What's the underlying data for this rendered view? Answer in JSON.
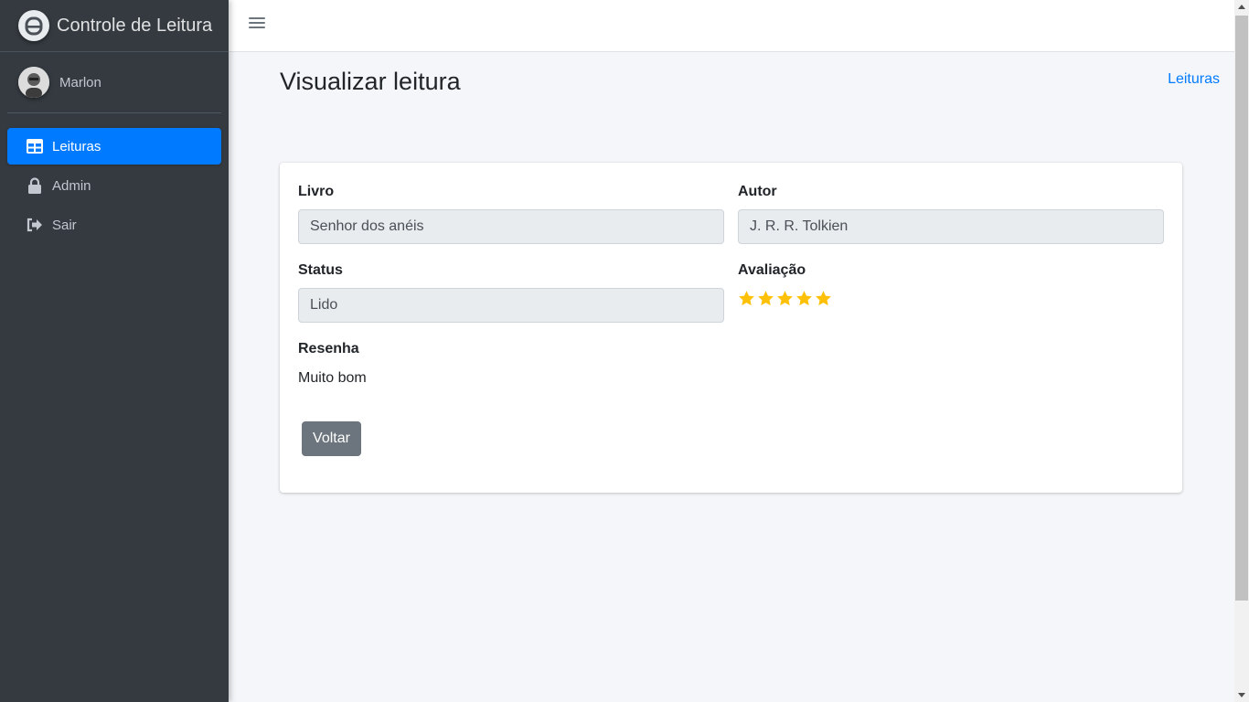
{
  "brand": {
    "title": "Controle de Leitura",
    "logo_icon": "app-logo-icon"
  },
  "user": {
    "name": "Marlon"
  },
  "sidebar": {
    "items": [
      {
        "label": "Leituras",
        "icon": "table-icon",
        "active": true
      },
      {
        "label": "Admin",
        "icon": "lock-icon",
        "active": false
      },
      {
        "label": "Sair",
        "icon": "sign-out-icon",
        "active": false
      }
    ]
  },
  "header": {
    "menu_icon": "hamburger-icon"
  },
  "page": {
    "title": "Visualizar leitura",
    "breadcrumb": "Leituras"
  },
  "form": {
    "livro_label": "Livro",
    "livro_value": "Senhor dos anéis",
    "autor_label": "Autor",
    "autor_value": "J. R. R. Tolkien",
    "status_label": "Status",
    "status_value": "Lido",
    "avaliacao_label": "Avaliação",
    "avaliacao_rating": 5,
    "avaliacao_max": 5,
    "resenha_label": "Resenha",
    "resenha_value": "Muito bom",
    "back_label": "Voltar"
  },
  "colors": {
    "sidebar_bg": "#343a40",
    "accent": "#007bff",
    "star": "#ffc107",
    "button_secondary": "#6c757d"
  }
}
